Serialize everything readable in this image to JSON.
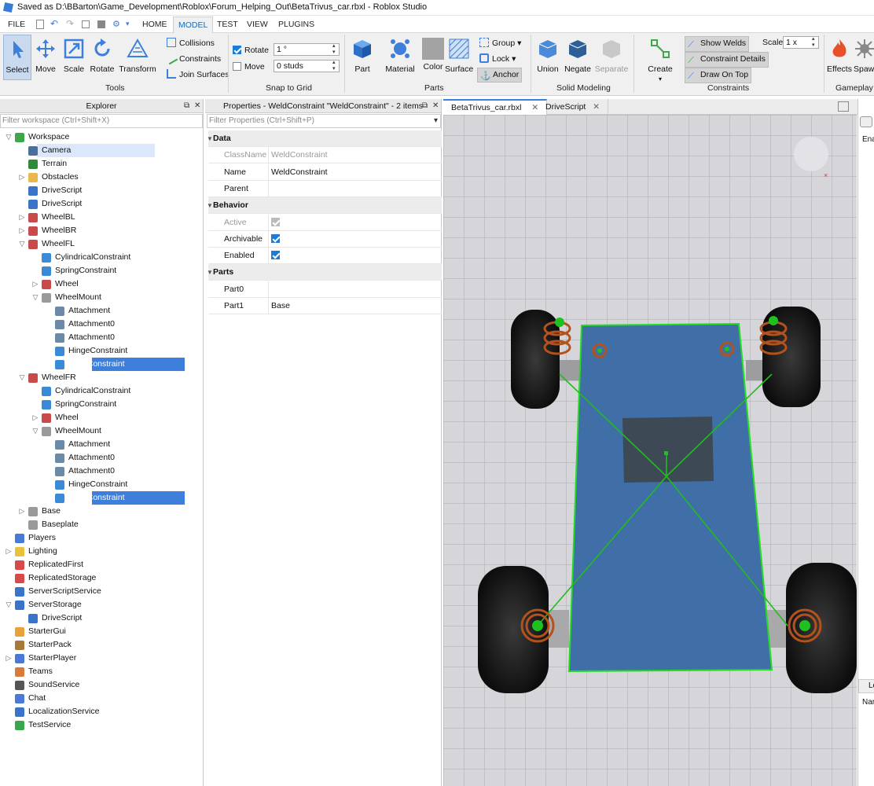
{
  "window": {
    "title": "Saved as D:\\BBarton\\Game_Development\\Roblox\\Forum_Helping_Out\\BetaTrivus_car.rbxl - Roblox Studio"
  },
  "menu": {
    "file": "FILE",
    "home": "HOME",
    "model": "MODEL",
    "test": "TEST",
    "view": "VIEW",
    "plugins": "PLUGINS"
  },
  "ribbon": {
    "tools": {
      "select": "Select",
      "move": "Move",
      "scale": "Scale",
      "rotate": "Rotate",
      "transform": "Transform",
      "label": "Tools"
    },
    "collisions": "Collisions",
    "constraints": "Constraints",
    "join_surfaces": "Join Surfaces",
    "snap": {
      "rotate_label": "Rotate",
      "rotate_value": "1 °",
      "move_label": "Move",
      "move_value": "0 studs",
      "label": "Snap to Grid",
      "rotate_checked": true,
      "move_checked": false
    },
    "parts": {
      "part": "Part",
      "material": "Material",
      "color": "Color",
      "surface": "Surface",
      "group": "Group",
      "lock": "Lock",
      "anchor": "Anchor",
      "label": "Parts"
    },
    "solid": {
      "union": "Union",
      "negate": "Negate",
      "separate": "Separate",
      "label": "Solid Modeling"
    },
    "constraints_group": {
      "create": "Create",
      "show_welds": "Show Welds",
      "constraint_details": "Constraint Details",
      "draw_on_top": "Draw On Top",
      "scale_label": "Scale",
      "scale_value": "1 x",
      "label": "Constraints"
    },
    "gameplay": {
      "effects": "Effects",
      "spawn": "Spaw",
      "label": "Gameplay"
    }
  },
  "explorer": {
    "title": "Explorer",
    "filter_placeholder": "Filter workspace (Ctrl+Shift+X)",
    "items": [
      {
        "label": "Workspace",
        "depth": 0,
        "arrow": "open",
        "icon": "workspace-icon",
        "color": "#3da84a"
      },
      {
        "label": "Camera",
        "depth": 1,
        "arrow": "",
        "icon": "camera-icon",
        "color": "#4a6e9a",
        "state": "hover"
      },
      {
        "label": "Terrain",
        "depth": 1,
        "arrow": "",
        "icon": "terrain-icon",
        "color": "#2f8a3a"
      },
      {
        "label": "Obstacles",
        "depth": 1,
        "arrow": "closed",
        "icon": "folder-icon",
        "color": "#e8b84a"
      },
      {
        "label": "DriveScript",
        "depth": 1,
        "arrow": "",
        "icon": "script-icon",
        "color": "#3a74c8"
      },
      {
        "label": "DriveScript",
        "depth": 1,
        "arrow": "",
        "icon": "script-icon",
        "color": "#3a74c8"
      },
      {
        "label": "WheelBL",
        "depth": 1,
        "arrow": "closed",
        "icon": "model-icon",
        "color": "#c84a4a"
      },
      {
        "label": "WheelBR",
        "depth": 1,
        "arrow": "closed",
        "icon": "model-icon",
        "color": "#c84a4a"
      },
      {
        "label": "WheelFL",
        "depth": 1,
        "arrow": "open",
        "icon": "model-icon",
        "color": "#c84a4a"
      },
      {
        "label": "CylindricalConstraint",
        "depth": 2,
        "arrow": "",
        "icon": "cylindrical-constraint-icon",
        "color": "#3a8ad8"
      },
      {
        "label": "SpringConstraint",
        "depth": 2,
        "arrow": "",
        "icon": "spring-constraint-icon",
        "color": "#3a8ad8"
      },
      {
        "label": "Wheel",
        "depth": 2,
        "arrow": "closed",
        "icon": "model-icon",
        "color": "#c84a4a"
      },
      {
        "label": "WheelMount",
        "depth": 2,
        "arrow": "open",
        "icon": "part-icon",
        "color": "#9a9a9a"
      },
      {
        "label": "Attachment",
        "depth": 3,
        "arrow": "",
        "icon": "attachment-icon",
        "color": "#6a8aa8"
      },
      {
        "label": "Attachment0",
        "depth": 3,
        "arrow": "",
        "icon": "attachment-icon",
        "color": "#6a8aa8"
      },
      {
        "label": "Attachment0",
        "depth": 3,
        "arrow": "",
        "icon": "attachment-icon",
        "color": "#6a8aa8"
      },
      {
        "label": "HingeConstraint",
        "depth": 3,
        "arrow": "",
        "icon": "hinge-constraint-icon",
        "color": "#3a8ad8"
      },
      {
        "label": "WeldConstraint",
        "depth": 3,
        "arrow": "",
        "icon": "weld-constraint-icon",
        "color": "#3a8ad8",
        "state": "selected"
      },
      {
        "label": "WheelFR",
        "depth": 1,
        "arrow": "open",
        "icon": "model-icon",
        "color": "#c84a4a"
      },
      {
        "label": "CylindricalConstraint",
        "depth": 2,
        "arrow": "",
        "icon": "cylindrical-constraint-icon",
        "color": "#3a8ad8"
      },
      {
        "label": "SpringConstraint",
        "depth": 2,
        "arrow": "",
        "icon": "spring-constraint-icon",
        "color": "#3a8ad8"
      },
      {
        "label": "Wheel",
        "depth": 2,
        "arrow": "closed",
        "icon": "model-icon",
        "color": "#c84a4a"
      },
      {
        "label": "WheelMount",
        "depth": 2,
        "arrow": "open",
        "icon": "part-icon",
        "color": "#9a9a9a"
      },
      {
        "label": "Attachment",
        "depth": 3,
        "arrow": "",
        "icon": "attachment-icon",
        "color": "#6a8aa8"
      },
      {
        "label": "Attachment0",
        "depth": 3,
        "arrow": "",
        "icon": "attachment-icon",
        "color": "#6a8aa8"
      },
      {
        "label": "Attachment0",
        "depth": 3,
        "arrow": "",
        "icon": "attachment-icon",
        "color": "#6a8aa8"
      },
      {
        "label": "HingeConstraint",
        "depth": 3,
        "arrow": "",
        "icon": "hinge-constraint-icon",
        "color": "#3a8ad8"
      },
      {
        "label": "WeldConstraint",
        "depth": 3,
        "arrow": "",
        "icon": "weld-constraint-icon",
        "color": "#3a8ad8",
        "state": "selected"
      },
      {
        "label": "Base",
        "depth": 1,
        "arrow": "closed",
        "icon": "part-icon",
        "color": "#9a9a9a"
      },
      {
        "label": "Baseplate",
        "depth": 1,
        "arrow": "",
        "icon": "part-icon",
        "color": "#9a9a9a"
      },
      {
        "label": "Players",
        "depth": 0,
        "arrow": "",
        "icon": "players-icon",
        "color": "#4a7ad8"
      },
      {
        "label": "Lighting",
        "depth": 0,
        "arrow": "closed",
        "icon": "lighting-icon",
        "color": "#e8c23a"
      },
      {
        "label": "ReplicatedFirst",
        "depth": 0,
        "arrow": "",
        "icon": "replicated-first-icon",
        "color": "#d84a4a"
      },
      {
        "label": "ReplicatedStorage",
        "depth": 0,
        "arrow": "",
        "icon": "replicated-storage-icon",
        "color": "#d84a4a"
      },
      {
        "label": "ServerScriptService",
        "depth": 0,
        "arrow": "",
        "icon": "server-script-service-icon",
        "color": "#3a74c8"
      },
      {
        "label": "ServerStorage",
        "depth": 0,
        "arrow": "open",
        "icon": "server-storage-icon",
        "color": "#3a74c8"
      },
      {
        "label": "DriveScript",
        "depth": 1,
        "arrow": "",
        "icon": "script-icon",
        "color": "#3a74c8"
      },
      {
        "label": "StarterGui",
        "depth": 0,
        "arrow": "",
        "icon": "starter-gui-icon",
        "color": "#e8a23a"
      },
      {
        "label": "StarterPack",
        "depth": 0,
        "arrow": "",
        "icon": "starter-pack-icon",
        "color": "#a87a3a"
      },
      {
        "label": "StarterPlayer",
        "depth": 0,
        "arrow": "closed",
        "icon": "starter-player-icon",
        "color": "#4a7ad8"
      },
      {
        "label": "Teams",
        "depth": 0,
        "arrow": "",
        "icon": "teams-icon",
        "color": "#d87a3a"
      },
      {
        "label": "SoundService",
        "depth": 0,
        "arrow": "",
        "icon": "sound-service-icon",
        "color": "#555555"
      },
      {
        "label": "Chat",
        "depth": 0,
        "arrow": "",
        "icon": "chat-icon",
        "color": "#4a7ad8"
      },
      {
        "label": "LocalizationService",
        "depth": 0,
        "arrow": "",
        "icon": "localization-service-icon",
        "color": "#3a74c8"
      },
      {
        "label": "TestService",
        "depth": 0,
        "arrow": "",
        "icon": "test-service-icon",
        "color": "#3aa84a"
      }
    ]
  },
  "properties": {
    "title": "Properties - WeldConstraint \"WeldConstraint\" - 2 items",
    "filter_placeholder": "Filter Properties (Ctrl+Shift+P)",
    "rows": [
      {
        "kind": "category",
        "name": "Data"
      },
      {
        "kind": "prop",
        "name": "ClassName",
        "value": "WeldConstraint",
        "dim": true
      },
      {
        "kind": "prop",
        "name": "Name",
        "value": "WeldConstraint"
      },
      {
        "kind": "prop",
        "name": "Parent",
        "value": ""
      },
      {
        "kind": "category",
        "name": "Behavior"
      },
      {
        "kind": "check",
        "name": "Active",
        "checked": true,
        "dim": true
      },
      {
        "kind": "check",
        "name": "Archivable",
        "checked": true
      },
      {
        "kind": "check",
        "name": "Enabled",
        "checked": true
      },
      {
        "kind": "category",
        "name": "Parts"
      },
      {
        "kind": "prop",
        "name": "Part0",
        "value": ""
      },
      {
        "kind": "prop",
        "name": "Part1",
        "value": "Base"
      }
    ]
  },
  "documents": {
    "tab1": "BetaTrivus_car.rbxl",
    "tab2": "DriveScript"
  },
  "right_panel": {
    "top_label": "Ena",
    "bottom_tab": "Lo",
    "bottom_label": "Nar"
  },
  "colors": {
    "accent": "#3d7fdb",
    "weld_green": "#22dd22",
    "base_blue": "#3f6fa6"
  }
}
